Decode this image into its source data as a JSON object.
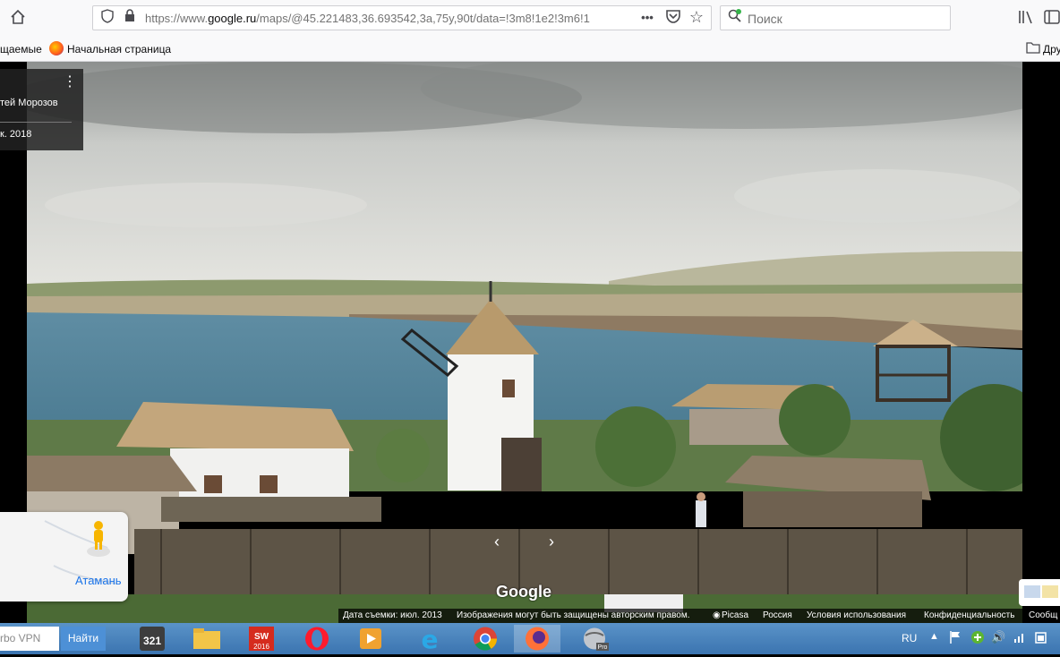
{
  "browser": {
    "url_prefix": "https://www.",
    "url_domain": "google.ru",
    "url_rest": "/maps/@45.221483,36.693542,3a,75y,90t/data=!3m8!1e2!3m6!1",
    "search_placeholder": "Поиск",
    "more_label": "•••"
  },
  "bookmarks": {
    "item1": "щаемые",
    "item2": "Начальная страница",
    "item3": "Дру"
  },
  "info_card": {
    "author": "тей Морозов",
    "date": "к. 2018"
  },
  "minimap": {
    "label": "Атамань"
  },
  "brand": {
    "logo": "Google"
  },
  "footer": {
    "capture_date": "Дата съемки: июл. 2013",
    "copyright": "Изображения могут быть защищены авторским правом.",
    "picasa": "Picasa",
    "country": "Россия",
    "terms": "Условия использования",
    "privacy": "Конфиденциальность",
    "more": "Сообщ"
  },
  "taskbar": {
    "vpn_label": "rbo VPN",
    "find_button": "Найти",
    "lang": "RU",
    "apps": [
      "media-player-321-icon",
      "file-explorer-icon",
      "solidworks-2016-icon",
      "opera-icon",
      "video-player-icon",
      "internet-explorer-icon",
      "chrome-icon",
      "firefox-icon",
      "google-earth-pro-icon"
    ]
  },
  "colors": {
    "accent": "#1a73e8",
    "taskbar": "#3b74b0"
  }
}
